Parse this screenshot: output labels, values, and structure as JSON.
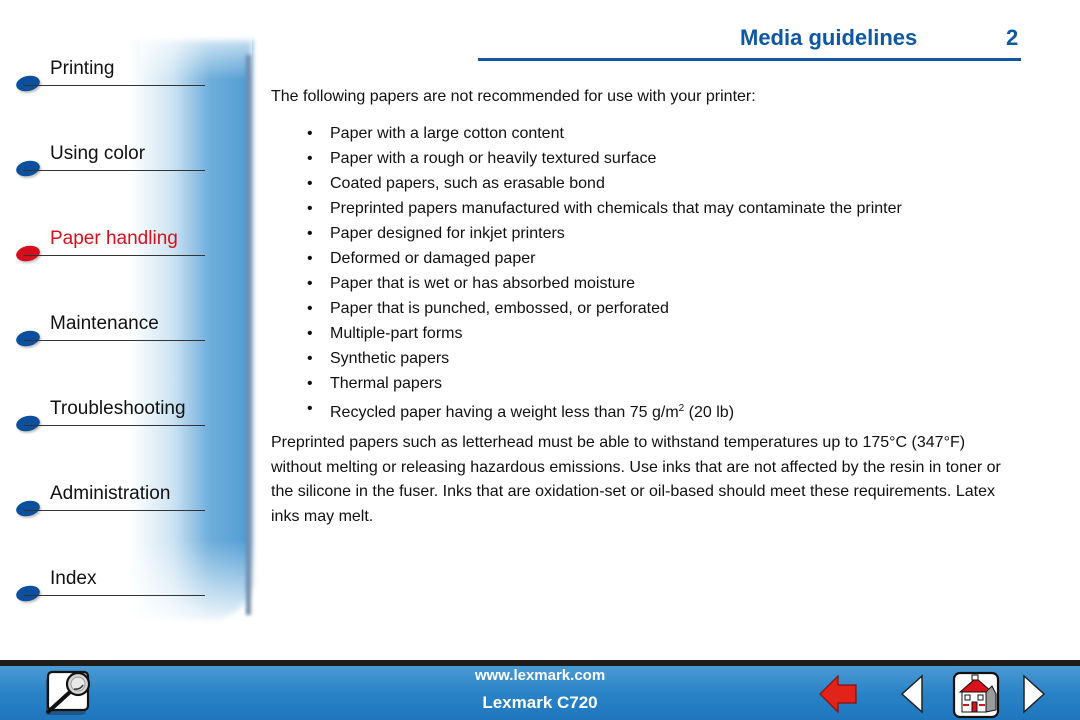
{
  "sidebar": {
    "items": [
      {
        "label": "Printing",
        "active": false
      },
      {
        "label": "Using color",
        "active": false
      },
      {
        "label": "Paper handling",
        "active": true
      },
      {
        "label": "Maintenance",
        "active": false
      },
      {
        "label": "Troubleshooting",
        "active": false
      },
      {
        "label": "Administration",
        "active": false
      },
      {
        "label": "Index",
        "active": false
      }
    ]
  },
  "header": {
    "title": "Media guidelines",
    "page_number": "2"
  },
  "content": {
    "intro": "The following papers are not recommended for use with your printer:",
    "bullet_glyph": "•",
    "bullets": [
      "Paper with a large cotton content",
      "Paper with a rough or heavily textured surface",
      "Coated papers, such as erasable bond",
      "Preprinted papers manufactured with chemicals that may contaminate the printer",
      "Paper designed for inkjet printers",
      "Deformed or damaged paper",
      "Paper that is wet or has absorbed moisture",
      "Paper that is punched, embossed, or perforated",
      "Multiple-part forms",
      "Synthetic papers",
      "Thermal papers"
    ],
    "last_bullet": {
      "before": "Recycled paper having a weight less than 75 g/m",
      "superscript": "2",
      "after": " (20 lb)"
    },
    "paragraph": "Preprinted papers such as letterhead must be able to withstand temperatures up to 175°C (347°F) without melting or releasing hazardous emissions. Use inks that are not affected by the resin in toner or the silicone in the fuser. Inks that are oxidation-set or oil-based should meet these requirements. Latex inks may melt."
  },
  "footer": {
    "website": "www.lexmark.com",
    "product": "Lexmark C720",
    "icons": {
      "search": "search-icon",
      "back": "back-arrow-icon",
      "prev": "previous-page-icon",
      "home": "home-icon",
      "next": "next-page-icon"
    }
  },
  "colors": {
    "accent_blue": "#0d57a3",
    "active_red": "#d4101c",
    "footer_blue": "#2a83c7"
  }
}
